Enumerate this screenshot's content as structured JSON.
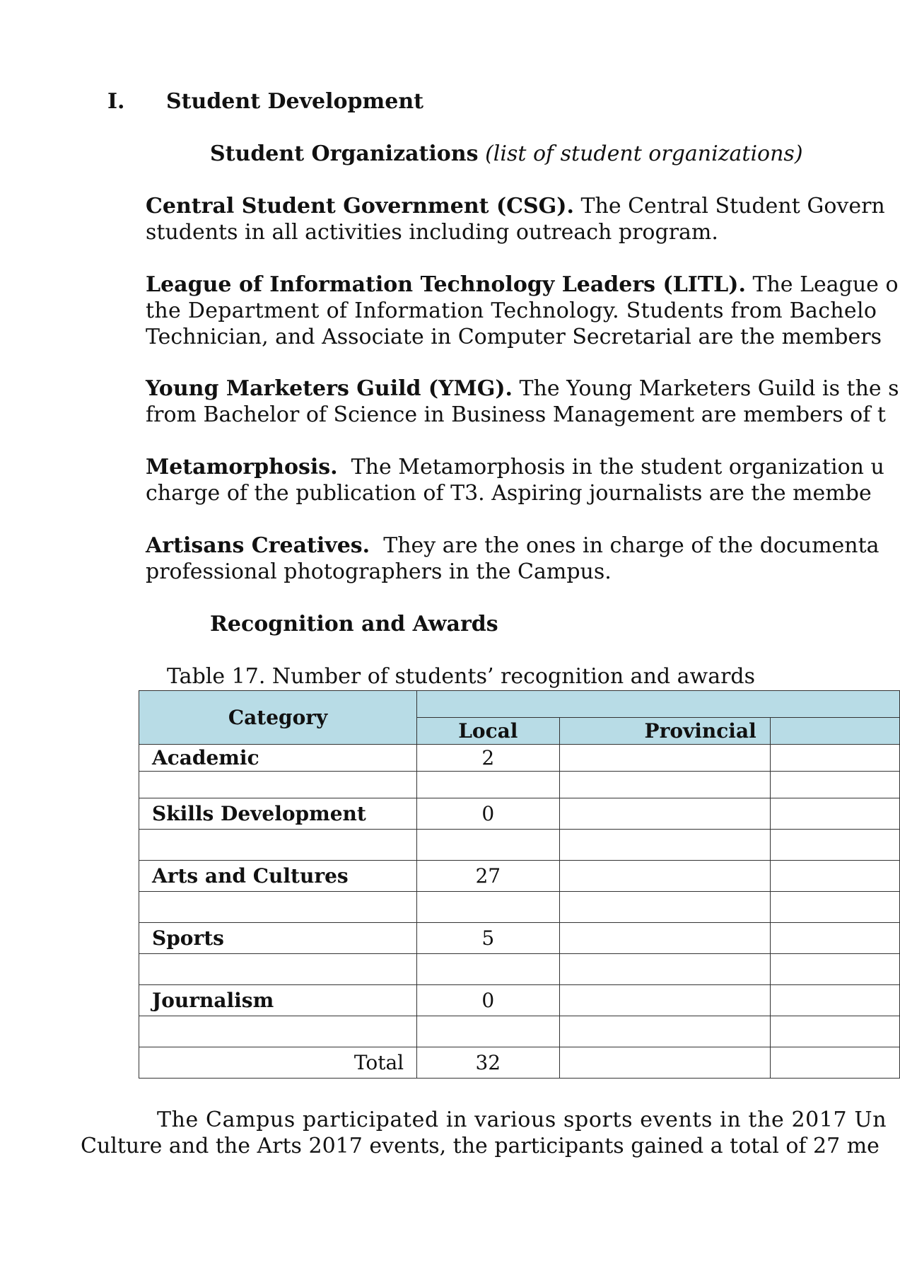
{
  "section": {
    "number": "I.",
    "title": "Student Development"
  },
  "organizations": {
    "heading": "Student Organizations",
    "heading_note": "(list of student organizations)",
    "items": [
      {
        "name": "Central Student Government (CSG).",
        "line1": "The Central Student Govern",
        "line2": "students in all activities including outreach program."
      },
      {
        "name": "League of Information Technology Leaders (LITL).",
        "line1": "The League o",
        "line2": "the Department of Information Technology. Students from Bachelo",
        "line3": "Technician, and Associate in Computer Secretarial are the members"
      },
      {
        "name": "Young Marketers Guild (YMG).",
        "line1": "The Young Marketers Guild is the s",
        "line2": "from Bachelor of Science in Business Management are members of t"
      },
      {
        "name": "Metamorphosis.",
        "line1": " The Metamorphosis in the student organization u",
        "line2": "charge of the publication of T3.  Aspiring journalists are the membe"
      },
      {
        "name": "Artisans Creatives.",
        "line1": " They are the ones in charge of the documenta",
        "line2": "professional photographers in the Campus."
      }
    ]
  },
  "awards": {
    "heading": "Recognition and Awards",
    "caption": "Table 17. Number of students’ recognition and awards",
    "columns": [
      "Category",
      "Local",
      "Provincial"
    ],
    "rows": [
      {
        "category": "Academic",
        "local": "2"
      },
      {
        "category": "",
        "local": ""
      },
      {
        "category": "Skills Development",
        "local": "0"
      },
      {
        "category": "",
        "local": ""
      },
      {
        "category": "Arts and Cultures",
        "local": "27"
      },
      {
        "category": "",
        "local": ""
      },
      {
        "category": "Sports",
        "local": "5"
      },
      {
        "category": "",
        "local": ""
      },
      {
        "category": "Journalism",
        "local": "0"
      },
      {
        "category": "",
        "local": ""
      }
    ],
    "total_label": "Total",
    "total_local": "32"
  },
  "closing": {
    "line1": "The Campus participated in various sports events in the 2017 Un",
    "line2": "Culture and the Arts 2017 events, the participants gained a total of 27 me"
  }
}
